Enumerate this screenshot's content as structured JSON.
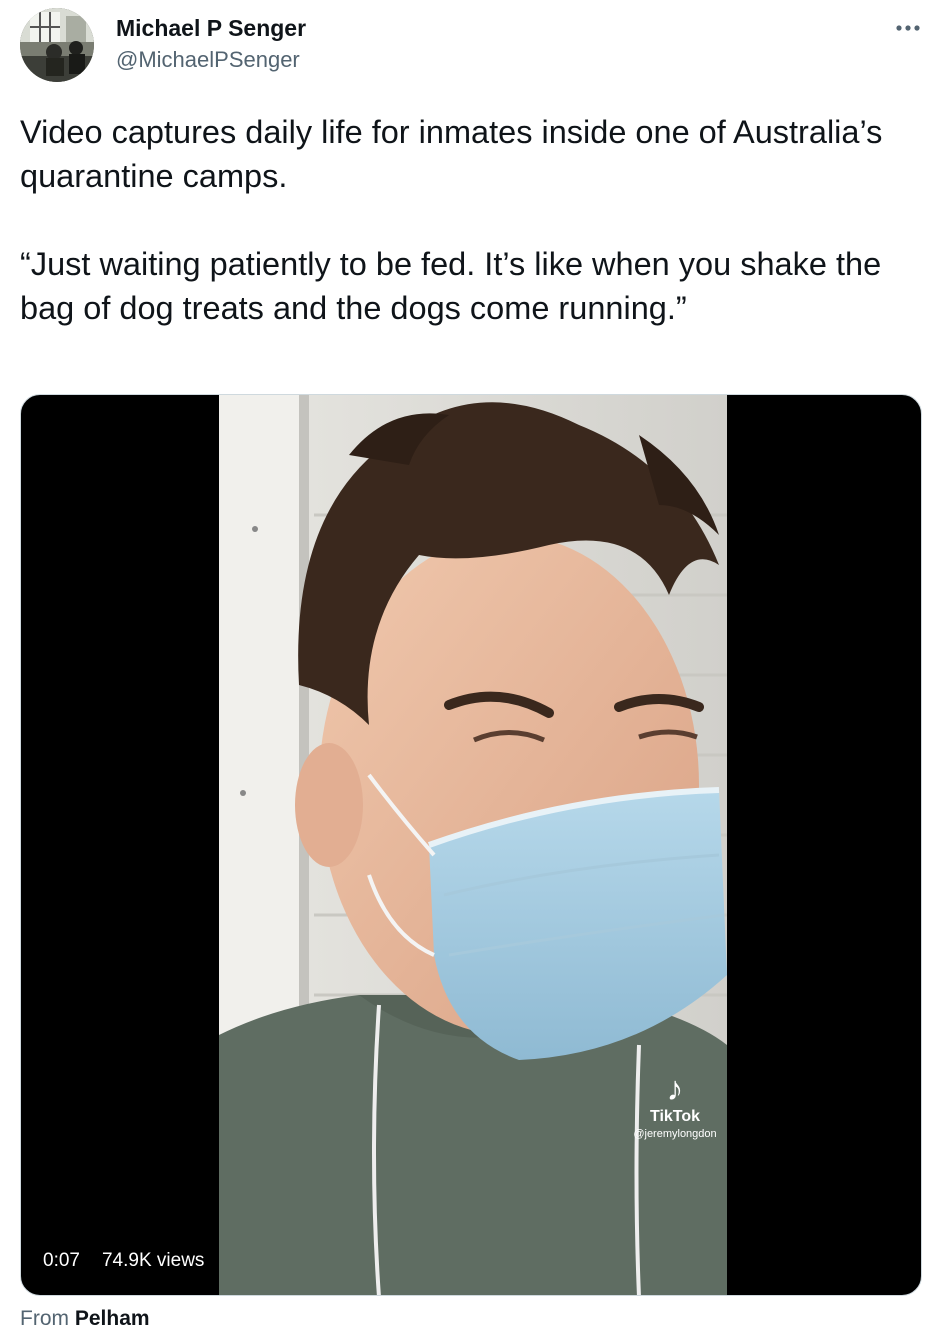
{
  "author": {
    "display_name": "Michael P Senger",
    "handle": "@MichaelPSenger",
    "avatar_icon": "profile-photo"
  },
  "more_icon": "more-dots-icon",
  "tweet": {
    "text": "Video captures daily life for inmates inside one of Australia’s quarantine camps.\n\n“Just waiting patiently to be fed. It’s like when you shake the bag of dog treats and the dogs come running.”"
  },
  "video": {
    "duration": "0:07",
    "views": "74.9K views",
    "watermark_logo_icon": "tiktok-logo-icon",
    "watermark_brand": "TikTok",
    "watermark_user": "@jeremylongdon"
  },
  "source": {
    "prefix": "From",
    "name": "Pelham"
  },
  "colors": {
    "text_primary": "#0f1419",
    "text_secondary": "#536471",
    "media_background": "#000000"
  }
}
